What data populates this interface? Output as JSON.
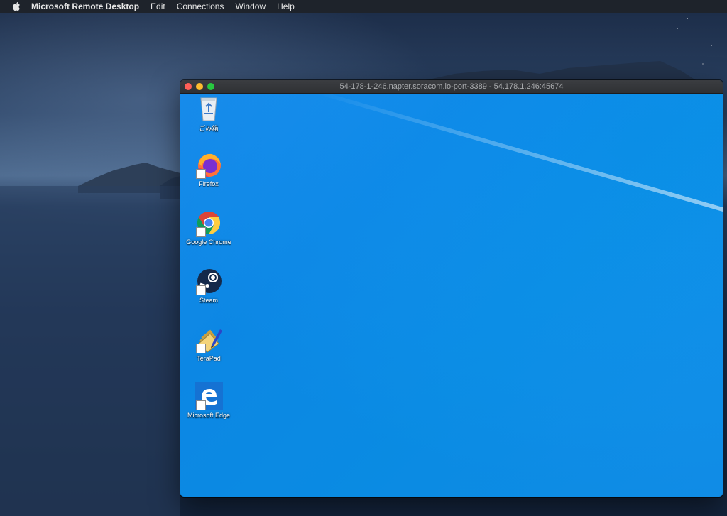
{
  "menubar": {
    "app_name": "Microsoft Remote Desktop",
    "items": [
      "Edit",
      "Connections",
      "Window",
      "Help"
    ]
  },
  "window": {
    "title": "54-178-1-246.napter.soracom.io-port-3389 - 54.178.1.246:45674"
  },
  "desktop_icons": [
    {
      "label": "ごみ箱",
      "icon": "recycle-bin-icon"
    },
    {
      "label": "Firefox",
      "icon": "firefox-icon"
    },
    {
      "label": "Google Chrome",
      "icon": "chrome-icon"
    },
    {
      "label": "Steam",
      "icon": "steam-icon"
    },
    {
      "label": "TeraPad",
      "icon": "terapad-icon"
    },
    {
      "label": "Microsoft Edge",
      "icon": "edge-icon"
    }
  ],
  "colors": {
    "remote_background": "#0d8ae8",
    "menubar": "#1e232b",
    "close": "#ff5f57",
    "minimize": "#febc2e",
    "maximize": "#28c840"
  }
}
